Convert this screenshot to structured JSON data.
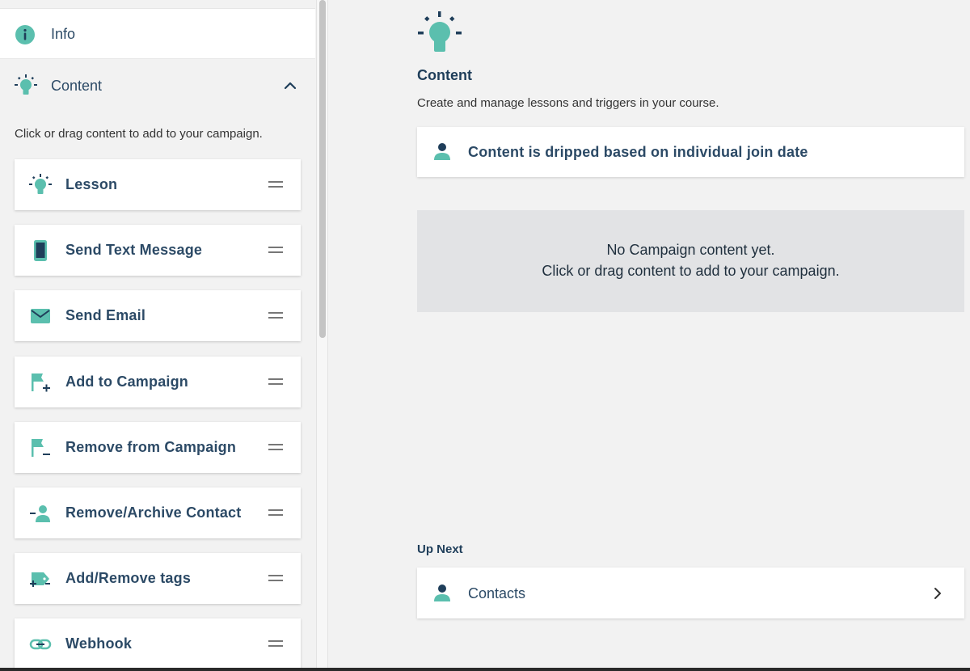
{
  "sidebar": {
    "info_label": "Info",
    "content_label": "Content",
    "hint": "Click or drag content to add to your campaign.",
    "items": [
      {
        "label": "Lesson",
        "icon": "lightbulb-icon"
      },
      {
        "label": "Send Text Message",
        "icon": "phone-icon"
      },
      {
        "label": "Send Email",
        "icon": "envelope-icon"
      },
      {
        "label": "Add to Campaign",
        "icon": "flag-plus-icon"
      },
      {
        "label": "Remove from Campaign",
        "icon": "flag-minus-icon"
      },
      {
        "label": "Remove/Archive Contact",
        "icon": "person-minus-icon"
      },
      {
        "label": "Add/Remove tags",
        "icon": "tag-icon"
      },
      {
        "label": "Webhook",
        "icon": "link-icon"
      }
    ]
  },
  "main": {
    "title": "Content",
    "subtitle": "Create and manage lessons and triggers in your course.",
    "drip_text": "Content is dripped based on individual join date",
    "empty_line1": "No Campaign content yet.",
    "empty_line2": "Click or drag content to add to your campaign.",
    "up_next_label": "Up Next",
    "next_item": "Contacts"
  },
  "colors": {
    "accent": "#5bbfae",
    "text": "#2c4a66",
    "icon_dark": "#2c4a66",
    "background": "#f2f2f2",
    "empty_box": "#e2e3e5"
  }
}
